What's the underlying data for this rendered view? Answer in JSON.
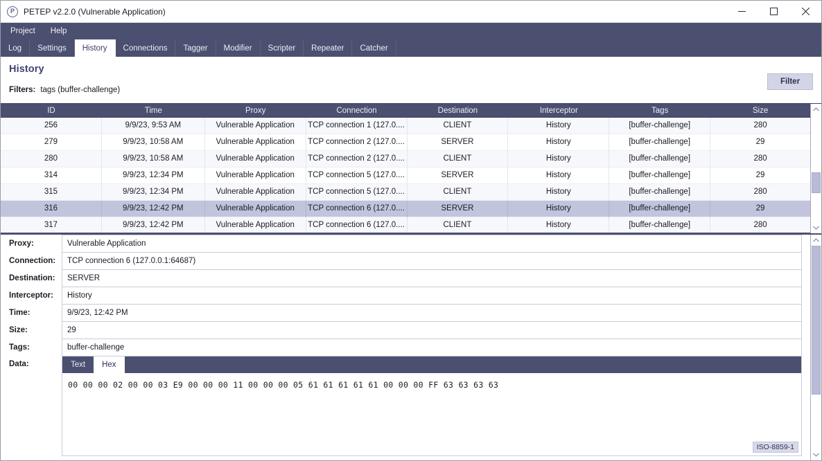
{
  "window": {
    "title": "PETEP v2.2.0 (Vulnerable Application)",
    "app_icon": "petep-logo-icon",
    "minimize_label": "–",
    "maximize_label": "☐",
    "close_label": "✕"
  },
  "menubar": {
    "items": [
      {
        "label": "Project"
      },
      {
        "label": "Help"
      }
    ]
  },
  "tabs": [
    {
      "label": "Log",
      "active": false
    },
    {
      "label": "Settings",
      "active": false
    },
    {
      "label": "History",
      "active": true
    },
    {
      "label": "Connections",
      "active": false
    },
    {
      "label": "Tagger",
      "active": false
    },
    {
      "label": "Modifier",
      "active": false
    },
    {
      "label": "Scripter",
      "active": false
    },
    {
      "label": "Repeater",
      "active": false
    },
    {
      "label": "Catcher",
      "active": false
    }
  ],
  "page": {
    "title": "History",
    "filters_label": "Filters:",
    "filters_value": "tags (buffer-challenge)",
    "filter_button": "Filter"
  },
  "table": {
    "columns": [
      "ID",
      "Time",
      "Proxy",
      "Connection",
      "Destination",
      "Interceptor",
      "Tags",
      "Size"
    ],
    "rows": [
      {
        "id": "256",
        "time": "9/9/23, 9:53 AM",
        "proxy": "Vulnerable Application",
        "connection": "TCP connection 1 (127.0....",
        "destination": "CLIENT",
        "interceptor": "History",
        "tags": "[buffer-challenge]",
        "size": "280",
        "selected": false
      },
      {
        "id": "279",
        "time": "9/9/23, 10:58 AM",
        "proxy": "Vulnerable Application",
        "connection": "TCP connection 2 (127.0....",
        "destination": "SERVER",
        "interceptor": "History",
        "tags": "[buffer-challenge]",
        "size": "29",
        "selected": false
      },
      {
        "id": "280",
        "time": "9/9/23, 10:58 AM",
        "proxy": "Vulnerable Application",
        "connection": "TCP connection 2 (127.0....",
        "destination": "CLIENT",
        "interceptor": "History",
        "tags": "[buffer-challenge]",
        "size": "280",
        "selected": false
      },
      {
        "id": "314",
        "time": "9/9/23, 12:34 PM",
        "proxy": "Vulnerable Application",
        "connection": "TCP connection 5 (127.0....",
        "destination": "SERVER",
        "interceptor": "History",
        "tags": "[buffer-challenge]",
        "size": "29",
        "selected": false
      },
      {
        "id": "315",
        "time": "9/9/23, 12:34 PM",
        "proxy": "Vulnerable Application",
        "connection": "TCP connection 5 (127.0....",
        "destination": "CLIENT",
        "interceptor": "History",
        "tags": "[buffer-challenge]",
        "size": "280",
        "selected": false
      },
      {
        "id": "316",
        "time": "9/9/23, 12:42 PM",
        "proxy": "Vulnerable Application",
        "connection": "TCP connection 6 (127.0....",
        "destination": "SERVER",
        "interceptor": "History",
        "tags": "[buffer-challenge]",
        "size": "29",
        "selected": true
      },
      {
        "id": "317",
        "time": "9/9/23, 12:42 PM",
        "proxy": "Vulnerable Application",
        "connection": "TCP connection 6 (127.0....",
        "destination": "CLIENT",
        "interceptor": "History",
        "tags": "[buffer-challenge]",
        "size": "280",
        "selected": false
      }
    ]
  },
  "details": {
    "fields": [
      {
        "label": "Proxy:",
        "value": "Vulnerable Application"
      },
      {
        "label": "Connection:",
        "value": "TCP connection 6 (127.0.0.1:64687)"
      },
      {
        "label": "Destination:",
        "value": "SERVER"
      },
      {
        "label": "Interceptor:",
        "value": "History"
      },
      {
        "label": "Time:",
        "value": "9/9/23, 12:42 PM"
      },
      {
        "label": "Size:",
        "value": "29"
      },
      {
        "label": "Tags:",
        "value": "buffer-challenge"
      }
    ],
    "data_label": "Data:",
    "data_tabs": [
      {
        "label": "Text",
        "active": false
      },
      {
        "label": "Hex",
        "active": true
      }
    ],
    "hex": "00 00 00 02 00 00 03 E9 00 00 00 11 00 00 00 05 61 61 61 61 61 00 00 00 FF 63 63 63 63",
    "encoding": "ISO-8859-1"
  },
  "colors": {
    "chrome": "#4b4f70",
    "accent": "#3f4470",
    "selection": "#c2c4dd",
    "scroll_thumb": "#b9bcd7",
    "button": "#d3d5e6"
  }
}
